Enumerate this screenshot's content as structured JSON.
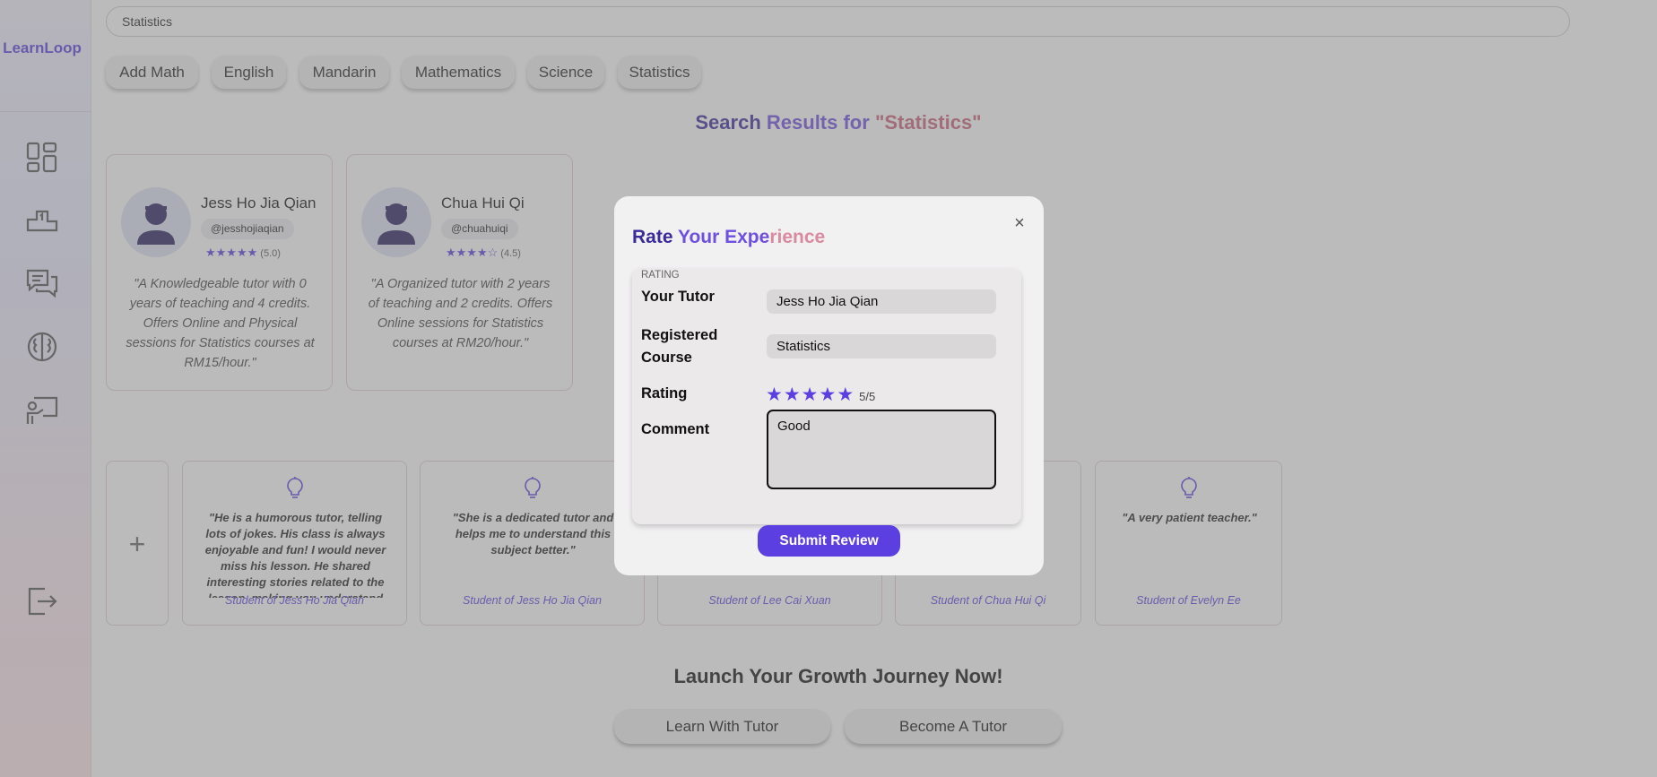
{
  "app": {
    "logo": "LearnLoop"
  },
  "search": {
    "value": "Statistics"
  },
  "chips": [
    "Add Math",
    "English",
    "Mandarin",
    "Mathematics",
    "Science",
    "Statistics"
  ],
  "results": {
    "prefix_a": "Search",
    "prefix_b": "Results for",
    "query": "\"Statistics\""
  },
  "tutors": [
    {
      "name": "Jess Ho Jia Qian",
      "handle": "@jesshojiaqian",
      "stars": "★★★★★",
      "score": "(5.0)",
      "desc": "\"A Knowledgeable tutor with 0 years of teaching and 4 credits. Offers Online and Physical sessions for Statistics courses at RM15/hour.\""
    },
    {
      "name": "Chua Hui Qi",
      "handle": "@chuahuiqi",
      "stars": "★★★★☆",
      "score": "(4.5)",
      "desc": "\"A Organized tutor with 2 years of teaching and 2 credits. Offers Online sessions for Statistics courses at RM20/hour.\""
    }
  ],
  "add_review": "+",
  "reviews": [
    {
      "quote": "\"He is a humorous tutor, telling lots of jokes. His class is always enjoyable and fun! I would never miss his lesson. He shared interesting stories related to the lesson, making you understand the sub-",
      "student": "Student of Jess Ho Jia Qian"
    },
    {
      "quote": "\"She is a dedicated tutor and helps me to understand this subject better.\"",
      "student": "Student of Jess Ho Jia Qian"
    },
    {
      "quote": "",
      "student": "Student of Lee Cai Xuan"
    },
    {
      "quote": "",
      "student": "Student of Chua Hui Qi"
    },
    {
      "quote": "\"A very patient teacher.\"",
      "student": "Student of Evelyn Ee"
    }
  ],
  "launch": {
    "title": "Launch Your Growth Journey Now!",
    "learn_label": "Learn With Tutor",
    "become_label": "Become A Tutor"
  },
  "modal": {
    "title_a": "Rate",
    "title_b": "Your Expe",
    "title_c": "rience",
    "close": "×",
    "section_label": "RATING",
    "tutor_label": "Your Tutor",
    "tutor_value": "Jess Ho Jia Qian",
    "course_label_1": "Registered",
    "course_label_2": "Course",
    "course_value": "Statistics",
    "rating_label": "Rating",
    "rating_value": 5,
    "rating_count": "5/5",
    "comment_label": "Comment",
    "comment_value": "Good",
    "submit_label": "Submit Review"
  },
  "colors": {
    "accent": "#5b3fe0",
    "accent_dark": "#3b2a9a",
    "pink": "#c9627a"
  }
}
